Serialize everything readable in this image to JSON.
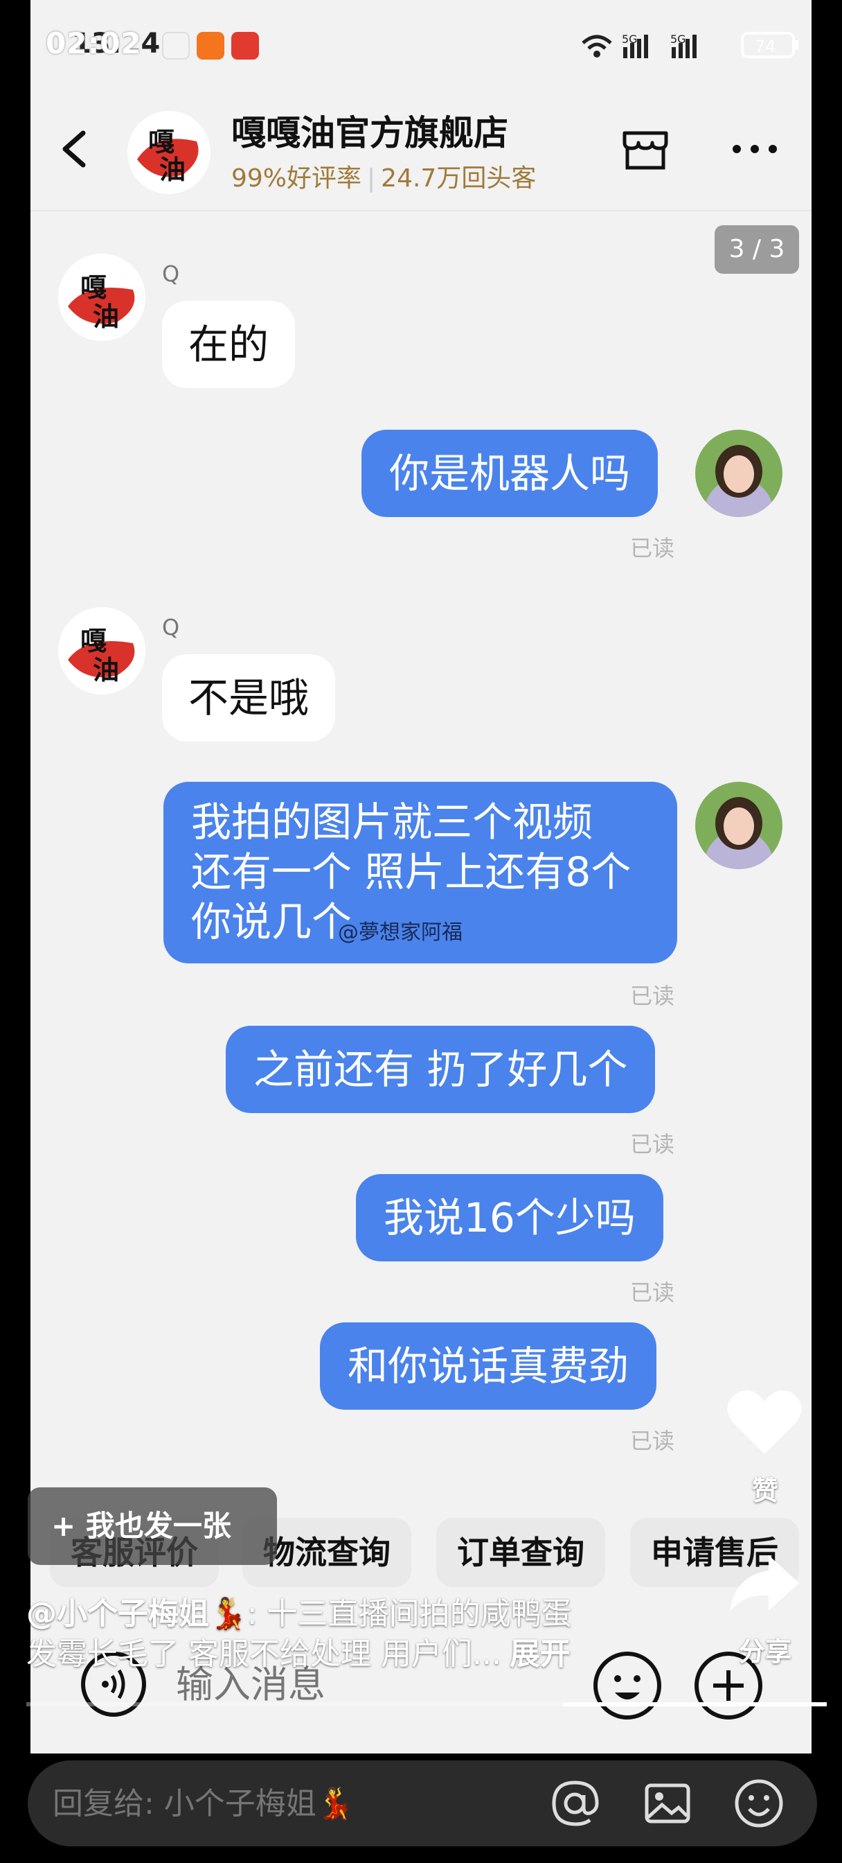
{
  "status_bar": {
    "time": "13:24",
    "time_overlay": "02:02",
    "battery": "74"
  },
  "header": {
    "shop_name": "嘎嘎油官方旗舰店",
    "rating": "99%好评率",
    "repeat_customers": "24.7万回头客",
    "logo_text": "嘎油"
  },
  "page_indicator": "3 / 3",
  "messages": [
    {
      "from": "agent",
      "label": "Q",
      "text": "在的"
    },
    {
      "from": "user",
      "text": "你是机器人吗",
      "status": "已读"
    },
    {
      "from": "agent",
      "label": "Q",
      "text": "不是哦"
    },
    {
      "from": "user",
      "lines": [
        "我拍的图片就三个视频",
        "还有一个 照片上还有8个",
        "你说几个"
      ],
      "status": "已读"
    },
    {
      "from": "user",
      "text": "之前还有 扔了好几个",
      "status": "已读"
    },
    {
      "from": "user",
      "text": "我说16个少吗",
      "status": "已读"
    },
    {
      "from": "user",
      "text": "和你说话真费劲",
      "status": "已读"
    }
  ],
  "watermark": "@夢想家阿福",
  "quick_actions": [
    "客服评价",
    "物流查询",
    "订单查询",
    "申请售后"
  ],
  "input": {
    "placeholder": "输入消息"
  },
  "overlay": {
    "post_button": "+ 我也发一张",
    "caption_user": "@小个子梅姐💃",
    "caption_text": ": 十三直播间拍的咸鸭蛋",
    "caption_line2": "发霉长毛了 客服不给处理 用户们...",
    "expand": "展开",
    "like_label": "赞",
    "share_label": "分享",
    "progress": 0.33
  },
  "comment": {
    "placeholder": "回复给: 小个子梅姐💃"
  },
  "colors": {
    "accent": "#4a83ec",
    "background": "#f2f2f2",
    "rating": "#a07a3a"
  }
}
